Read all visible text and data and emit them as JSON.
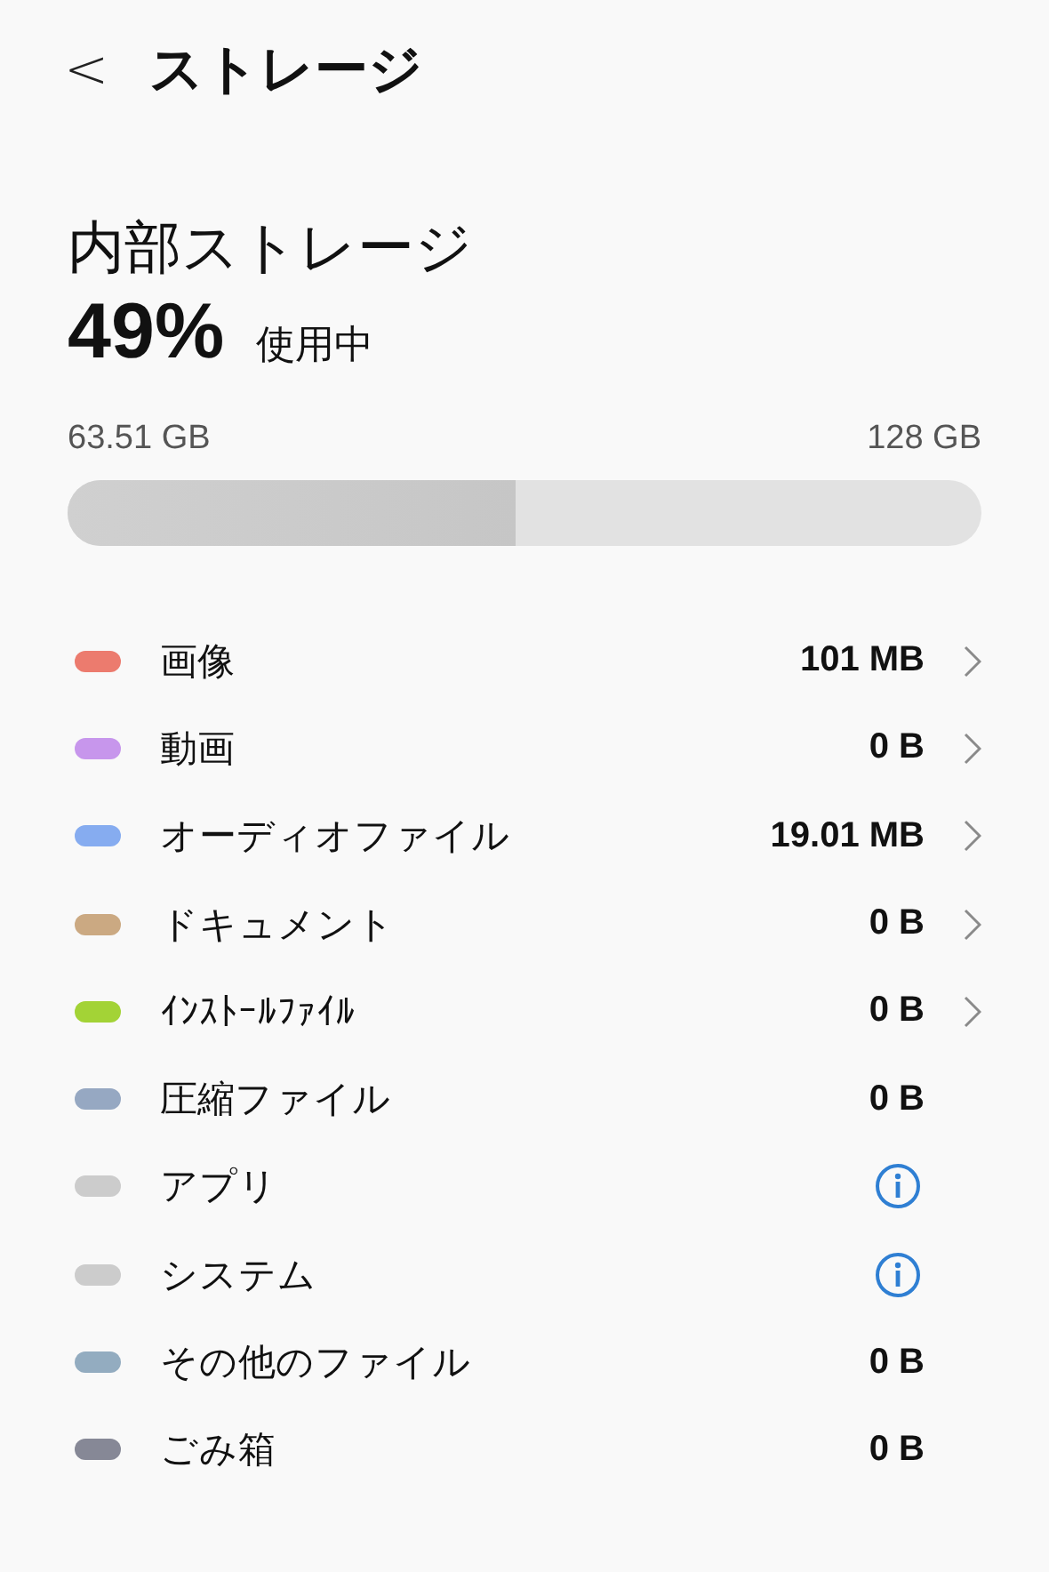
{
  "header": {
    "back": "<",
    "title": "ストレージ"
  },
  "storage": {
    "title": "内部ストレージ",
    "percent": "49%",
    "percent_label": "使用中",
    "used": "63.51 GB",
    "total": "128 GB",
    "level": 0.49
  },
  "categories": [
    {
      "name": "画像",
      "color": "#ec7b6e",
      "kind": "size",
      "value": "101 MB",
      "chevron": true
    },
    {
      "name": "動画",
      "color": "#c796ec",
      "kind": "size",
      "value": "0 B",
      "chevron": true
    },
    {
      "name": "オーディオファイル",
      "color": "#86acf0",
      "kind": "size",
      "value": "19.01 MB",
      "chevron": true
    },
    {
      "name": "ドキュメント",
      "color": "#cba982",
      "kind": "size",
      "value": "0 B",
      "chevron": true
    },
    {
      "name": "ｲﾝｽﾄｰﾙﾌｧｲﾙ",
      "color": "#a3d336",
      "kind": "size",
      "value": "0 B",
      "chevron": true
    },
    {
      "name": "圧縮ファイル",
      "color": "#96a8c2",
      "kind": "size",
      "value": "0 B",
      "chevron": false
    },
    {
      "name": "アプリ",
      "color": "#cccccc",
      "kind": "info",
      "chevron": false
    },
    {
      "name": "システム",
      "color": "#cccccc",
      "kind": "info",
      "chevron": false
    },
    {
      "name": "その他のファイル",
      "color": "#93acc0",
      "kind": "size",
      "value": "0 B",
      "chevron": false
    },
    {
      "name": "ごみ箱",
      "color": "#868896",
      "kind": "size",
      "value": "0 B",
      "chevron": false
    }
  ]
}
